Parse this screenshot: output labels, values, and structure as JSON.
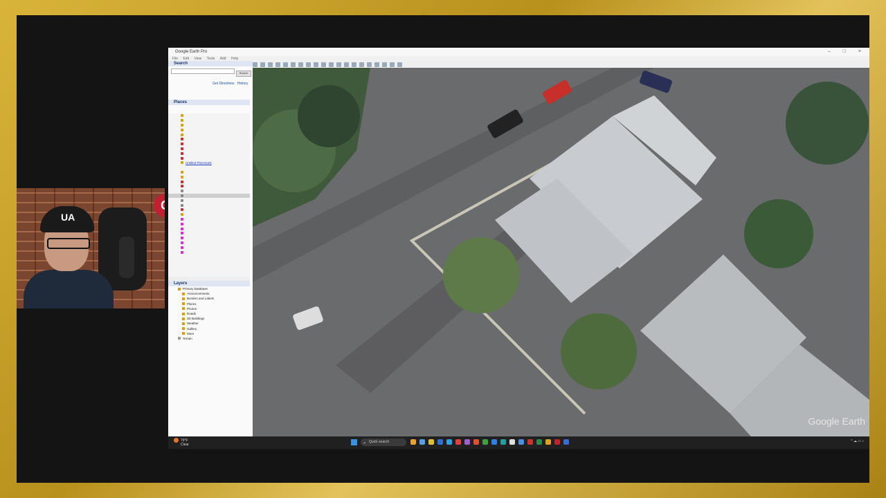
{
  "window": {
    "title": "Google Earth Pro",
    "controls": "–  □  ×"
  },
  "menu": [
    "File",
    "Edit",
    "View",
    "Tools",
    "Add",
    "Help"
  ],
  "panel": {
    "search_header": "Search",
    "search_button": "Search",
    "get_directions": "Get Directions",
    "history": "History",
    "places_header": "Places",
    "selected_placemark": "Untitled Placemark",
    "layers_header": "Layers",
    "layers": [
      "Primary Database",
      "Announcements",
      "Borders and Labels",
      "Places",
      "Photos",
      "Roads",
      "3D Buildings",
      "Weather",
      "Gallery",
      "More",
      "Terrain"
    ]
  },
  "map": {
    "watermark": "Google Earth"
  },
  "taskbar": {
    "weather_temp": "79°F",
    "weather_cond": "Clear",
    "search_placeholder": "Quick search"
  },
  "webcam": {
    "cap_logo": "UA",
    "badge": "G"
  },
  "colors": {
    "frame": "#c9a227",
    "accent_red": "#c02030"
  }
}
